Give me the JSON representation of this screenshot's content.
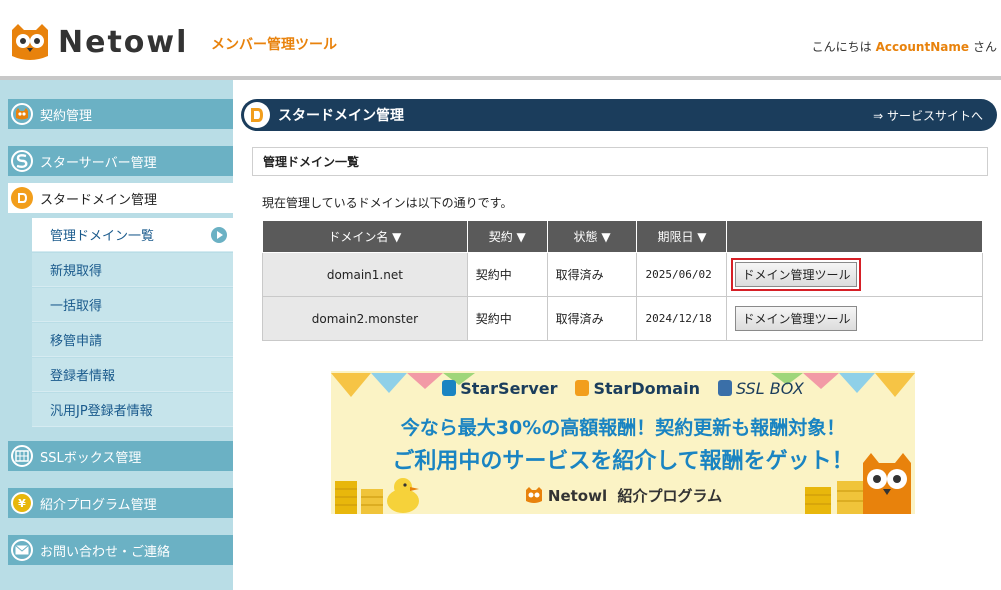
{
  "header": {
    "logo_text": "Netowl",
    "app_subtitle": "メンバー管理ツール",
    "greeting_prefix": "こんにちは",
    "account_name": "AccountName",
    "greeting_suffix": "さん"
  },
  "sidebar": {
    "items": [
      {
        "label": "契約管理",
        "icon": "owl-icon"
      },
      {
        "label": "スターサーバー管理",
        "icon": "starserver-icon"
      },
      {
        "label": "スタードメイン管理",
        "icon": "stardomain-icon"
      },
      {
        "label": "SSLボックス管理",
        "icon": "sslbox-icon"
      },
      {
        "label": "紹介プログラム管理",
        "icon": "yen-icon"
      },
      {
        "label": "お問い合わせ・ご連絡",
        "icon": "mail-icon"
      }
    ],
    "sub_items": [
      "管理ドメイン一覧",
      "新規取得",
      "一括取得",
      "移管申請",
      "登録者情報",
      "汎用JP登録者情報"
    ]
  },
  "main": {
    "title": "スタードメイン管理",
    "service_link": "⇒ サービスサイトへ",
    "section_title": "管理ドメイン一覧",
    "description": "現在管理しているドメインは以下の通りです。",
    "table": {
      "headers": [
        "ドメイン名 ▼",
        "契約 ▼",
        "状態 ▼",
        "期限日 ▼",
        ""
      ],
      "rows": [
        {
          "domain": "domain1.net",
          "contract": "契約中",
          "status": "取得済み",
          "expiry": "2025/06/02",
          "action": "ドメイン管理ツール"
        },
        {
          "domain": "domain2.monster",
          "contract": "契約中",
          "status": "取得済み",
          "expiry": "2024/12/18",
          "action": "ドメイン管理ツール"
        }
      ]
    }
  },
  "banner": {
    "brands": [
      "StarServer",
      "StarDomain",
      "SSL BOX"
    ],
    "line1": "今なら最大30%の高額報酬！契約更新も報酬対象！",
    "line2": "ご利用中のサービスを紹介して報酬をゲット！",
    "footer_brand": "Netowl",
    "footer_text": "紹介プログラム"
  },
  "colors": {
    "accent_orange": "#e8820c",
    "navy": "#1b3d5c",
    "sidebar_bg": "#b9dde6",
    "sidebar_teal": "#6bb1c4",
    "highlight_red": "#d61f26"
  }
}
